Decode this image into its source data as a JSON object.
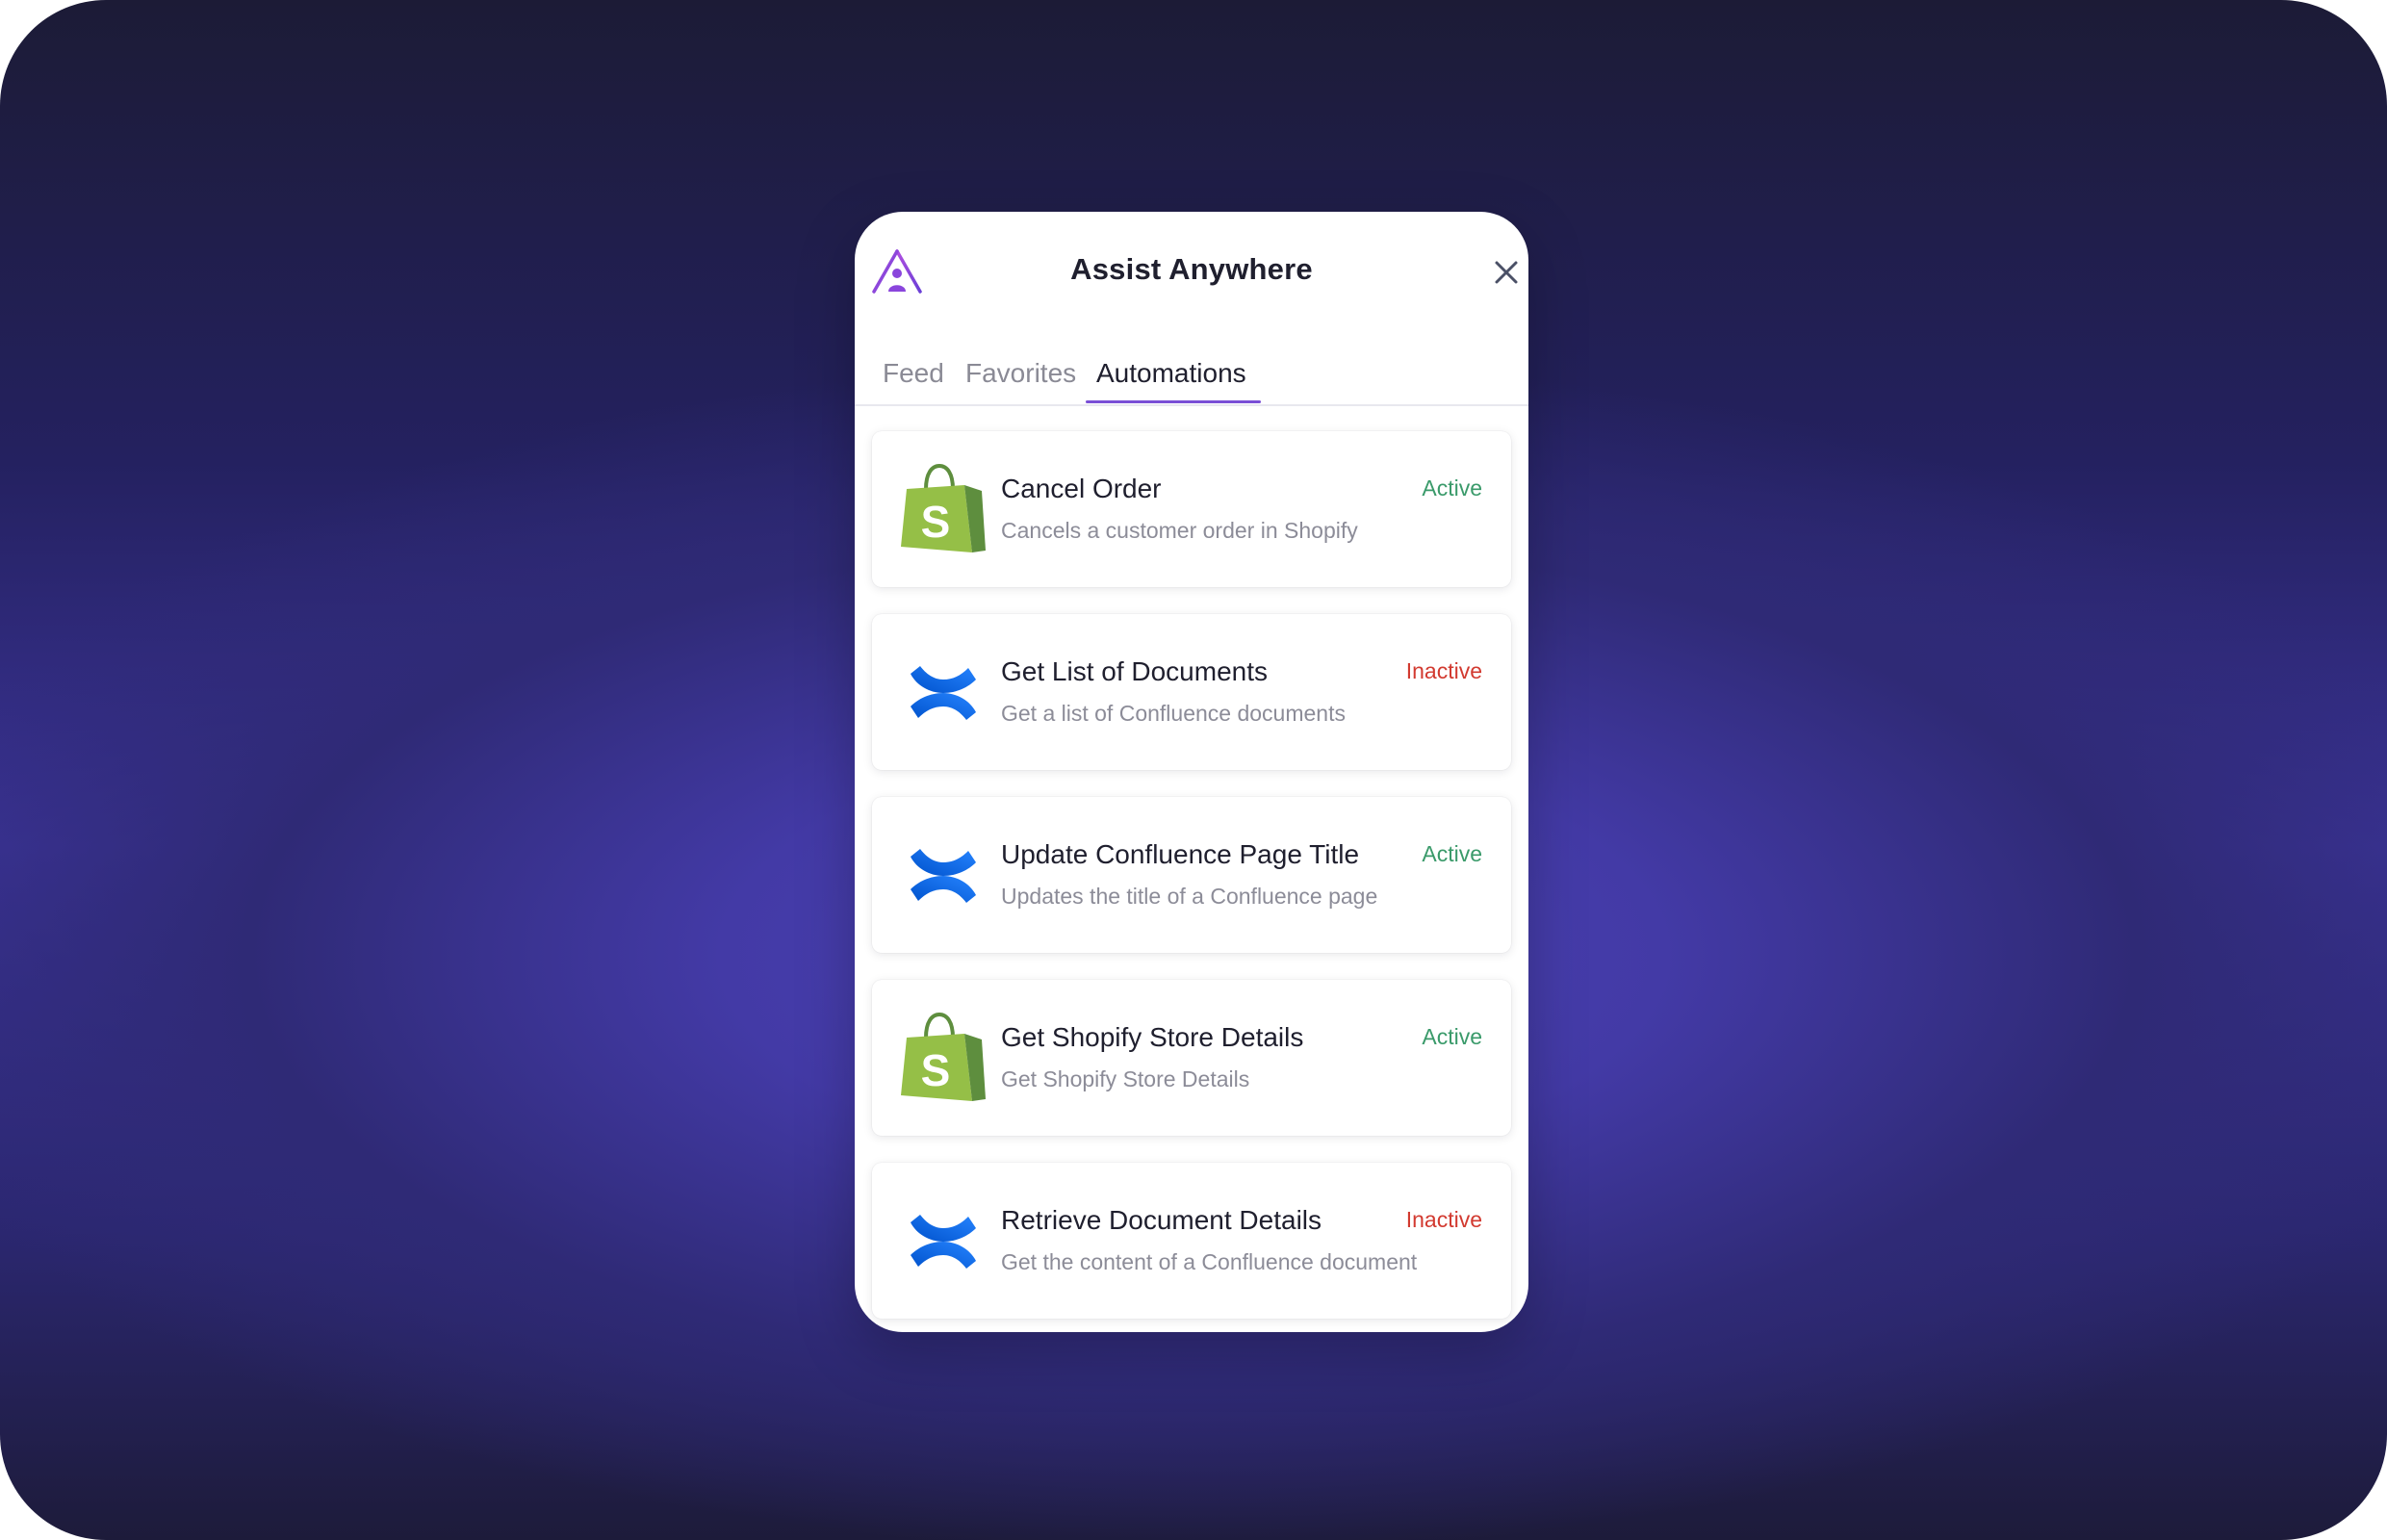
{
  "app": {
    "title": "Assist Anywhere",
    "logo_icon": "assist-anywhere-logo-icon",
    "close_icon": "close-icon"
  },
  "tabs": [
    {
      "label": "Feed",
      "active": false
    },
    {
      "label": "Favorites",
      "active": false
    },
    {
      "label": "Automations",
      "active": true
    }
  ],
  "colors": {
    "accent": "#7a4fd6",
    "active_status": "#3a9a6a",
    "inactive_status": "#d23a30",
    "shopify_green": "#95bf47",
    "confluence_blue": "#2684ff"
  },
  "automations": [
    {
      "name": "Cancel Order",
      "description": "Cancels a customer order in Shopify",
      "status": "Active",
      "app_icon": "shopify-icon"
    },
    {
      "name": "Get List of Documents",
      "description": "Get a list of Confluence documents",
      "status": "Inactive",
      "app_icon": "confluence-icon"
    },
    {
      "name": "Update Confluence Page Title",
      "description": "Updates the title of a Confluence page",
      "status": "Active",
      "app_icon": "confluence-icon"
    },
    {
      "name": "Get Shopify Store Details",
      "description": "Get Shopify Store Details",
      "status": "Active",
      "app_icon": "shopify-icon"
    },
    {
      "name": "Retrieve Document Details",
      "description": "Get the content of a Confluence document",
      "status": "Inactive",
      "app_icon": "confluence-icon"
    }
  ]
}
